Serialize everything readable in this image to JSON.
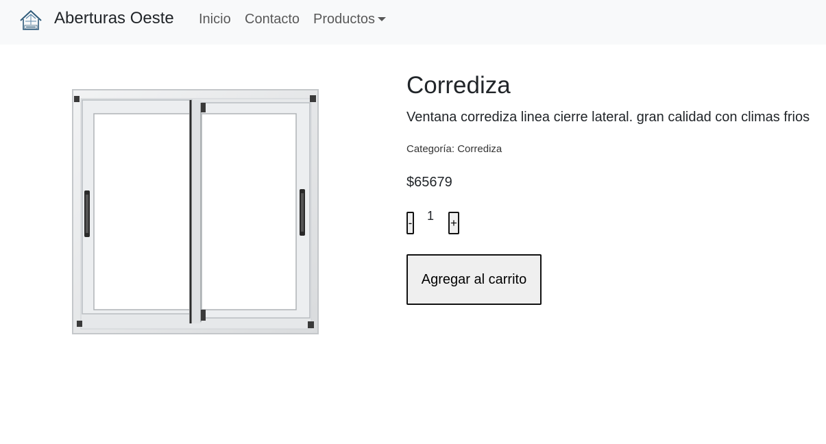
{
  "navbar": {
    "brand_name": "Aberturas Oeste",
    "logo_icon": "house-logo-icon",
    "links": [
      {
        "label": "Inicio"
      },
      {
        "label": "Contacto"
      },
      {
        "label": "Productos",
        "has_dropdown": true
      }
    ]
  },
  "product": {
    "image_icon": "sliding-window-image",
    "title": "Corrediza",
    "description": "Ventana corrediza linea cierre lateral. gran calidad con climas frios",
    "category_label": "Categoría:",
    "category_value": "Corrediza",
    "price": "$65679",
    "quantity": {
      "decrement_label": "-",
      "value": "1",
      "increment_label": "+"
    },
    "add_to_cart_label": "Agregar al carrito"
  },
  "colors": {
    "navbar_bg": "#f8f9fa",
    "text": "#212529",
    "button_bg": "#efefef"
  }
}
